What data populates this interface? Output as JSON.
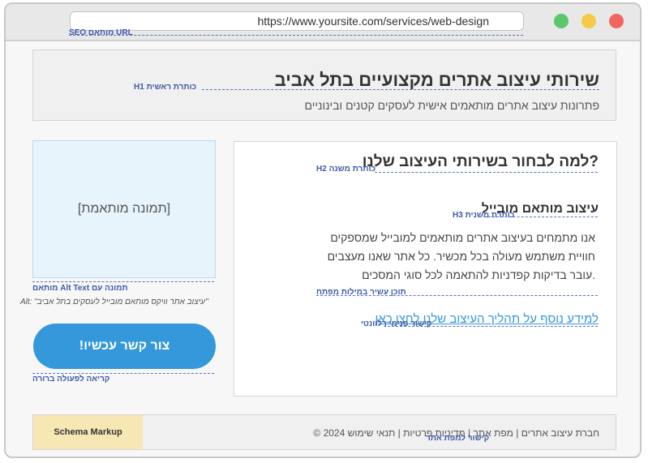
{
  "browser": {
    "url": "https://www.yoursite.com/services/web-design"
  },
  "header": {
    "title": "שירותי עיצוב אתרים מקצועיים בתל אביב",
    "subtitle": "פתרונות עיצוב אתרים מותאמים אישית לעסקים קטנים ובינוניים"
  },
  "image": {
    "placeholder": "[תמונה מותאמת]",
    "alt_text": "Alt: \"עיצוב אתר וויקס מותאם מובייל לעסקים בתל אביב\""
  },
  "cta": {
    "label": "צור קשר עכשיו!"
  },
  "content": {
    "h2": "?למה לבחור בשירותי העיצוב שלנו",
    "h3": "עיצוב מותאם מובייל",
    "paragraph_lines": [
      "אנו מתמחים בעיצוב אתרים מותאמים למובייל שמספקים",
      "חוויית משתמש מעולה בכל מכשיר. כל אתר שאנו מעצבים",
      ".עובר בדיקות קפדניות להתאמה לכל סוגי המסכים"
    ],
    "link": "למידע נוסף על תהליך העיצוב שלנו לחצו כאן"
  },
  "footer": {
    "schema": "Schema Markup",
    "text": "חברת עיצוב אתרים | מפת אתר | מדיניות פרטיות | תנאי שימוש 2024 ©"
  },
  "annotations": {
    "url": "URL מותאם SEO",
    "h1": "כותרת ראשית H1",
    "h2": "כותרת משנה H2",
    "h3": "כותרת משנית H3",
    "image": "תמונה עם Alt Text מותאם",
    "cta": "קריאה לפעולה ברורה",
    "keywords": "תוכן עשיר במילות מפתח",
    "internal_link": "קישור פנימי רלוונטי",
    "footer_links": "קישור למפת אתר"
  },
  "colors": {
    "annotation": "#3f5aa8",
    "cta": "#3498db",
    "schema": "#f7e7b4",
    "image_bg": "#e8f4fc"
  }
}
